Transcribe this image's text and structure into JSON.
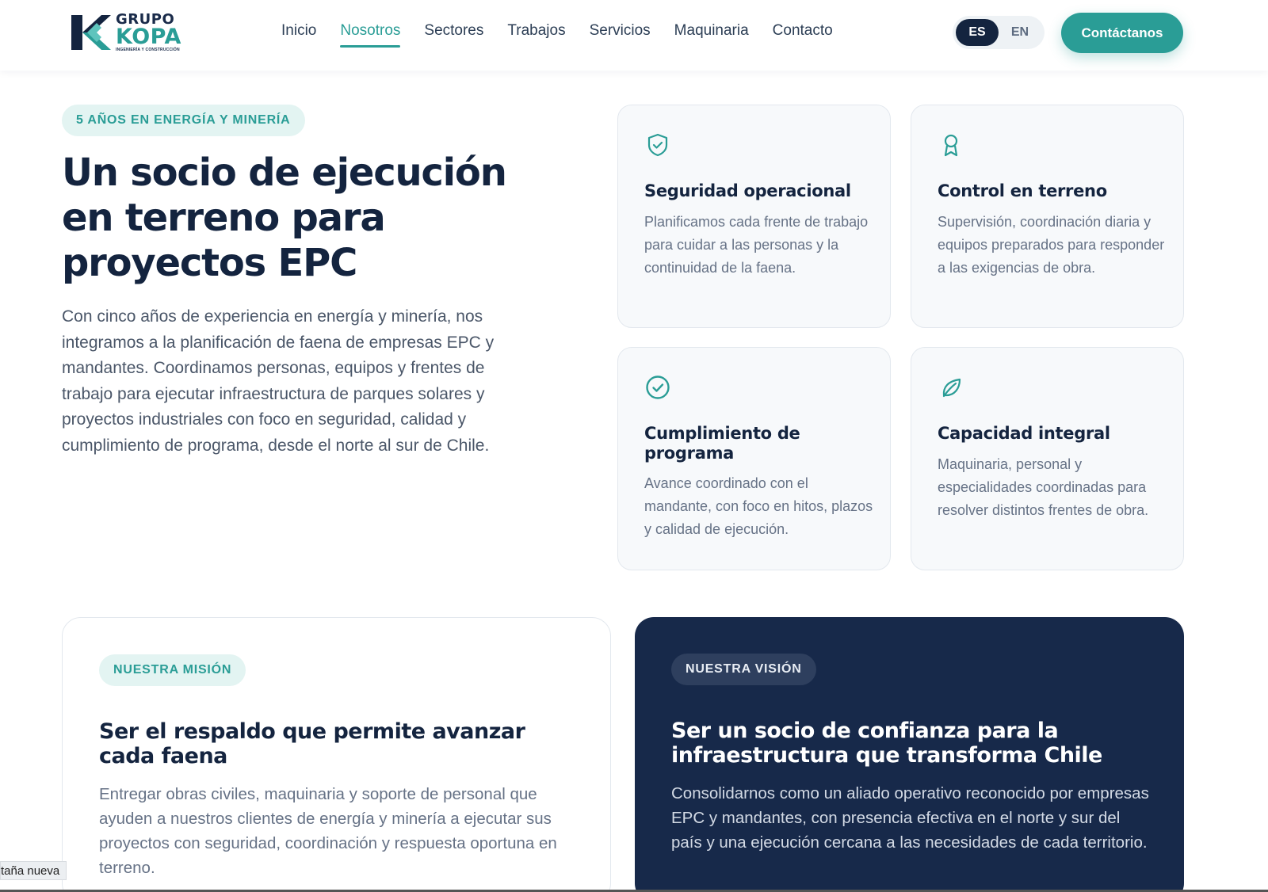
{
  "header": {
    "logo": {
      "line1": "GRUPO",
      "line2": "KOPA",
      "tagline": "INGENIERÍA Y CONSTRUCCIÓN"
    },
    "nav": [
      {
        "label": "Inicio",
        "active": false
      },
      {
        "label": "Nosotros",
        "active": true
      },
      {
        "label": "Sectores",
        "active": false
      },
      {
        "label": "Trabajos",
        "active": false
      },
      {
        "label": "Servicios",
        "active": false
      },
      {
        "label": "Maquinaria",
        "active": false
      },
      {
        "label": "Contacto",
        "active": false
      }
    ],
    "lang": {
      "es": "ES",
      "en": "EN",
      "selected": "ES"
    },
    "cta": "Contáctanos"
  },
  "hero": {
    "badge": "5 AÑOS EN ENERGÍA Y MINERÍA",
    "title": "Un socio de ejecución en terreno para proyectos EPC",
    "description": "Con cinco años de experiencia en energía y minería, nos integramos a la planificación de faena de empresas EPC y mandantes. Coordinamos personas, equipos y frentes de trabajo para ejecutar infraestructura de parques solares y proyectos industriales con foco en seguridad, calidad y cumplimiento de programa, desde el norte al sur de Chile."
  },
  "features": [
    {
      "icon": "shield-check-icon",
      "title": "Seguridad operacional",
      "description": "Planificamos cada frente de trabajo para cuidar a las personas y la continuidad de la faena."
    },
    {
      "icon": "award-icon",
      "title": "Control en terreno",
      "description": "Supervisión, coordinación diaria y equipos preparados para responder a las exigencias de obra."
    },
    {
      "icon": "check-circle-icon",
      "title": "Cumplimiento de programa",
      "description": "Avance coordinado con el mandante, con foco en hitos, plazos y calidad de ejecución."
    },
    {
      "icon": "leaf-icon",
      "title": "Capacidad integral",
      "description": "Maquinaria, personal y especialidades coordinadas para resolver distintos frentes de obra."
    }
  ],
  "mission": {
    "badge": "NUESTRA MISIÓN",
    "title": "Ser el respaldo que permite avanzar cada faena",
    "description": "Entregar obras civiles, maquinaria y soporte de personal que ayuden a nuestros clientes de energía y minería a ejecutar sus proyectos con seguridad, coordinación y respuesta oportuna en terreno."
  },
  "vision": {
    "badge": "NUESTRA VISIÓN",
    "title": "Ser un socio de confianza para la infraestructura que transforma Chile",
    "description": "Consolidarnos como un aliado operativo reconocido por empresas EPC y mandantes, con presencia efectiva en el norte y sur del país y una ejecución cercana a las necesidades de cada territorio."
  },
  "browser_tooltip": "taña nueva",
  "colors": {
    "accent": "#2a9d96",
    "navy": "#14243f",
    "vision_bg": "#17294a"
  }
}
